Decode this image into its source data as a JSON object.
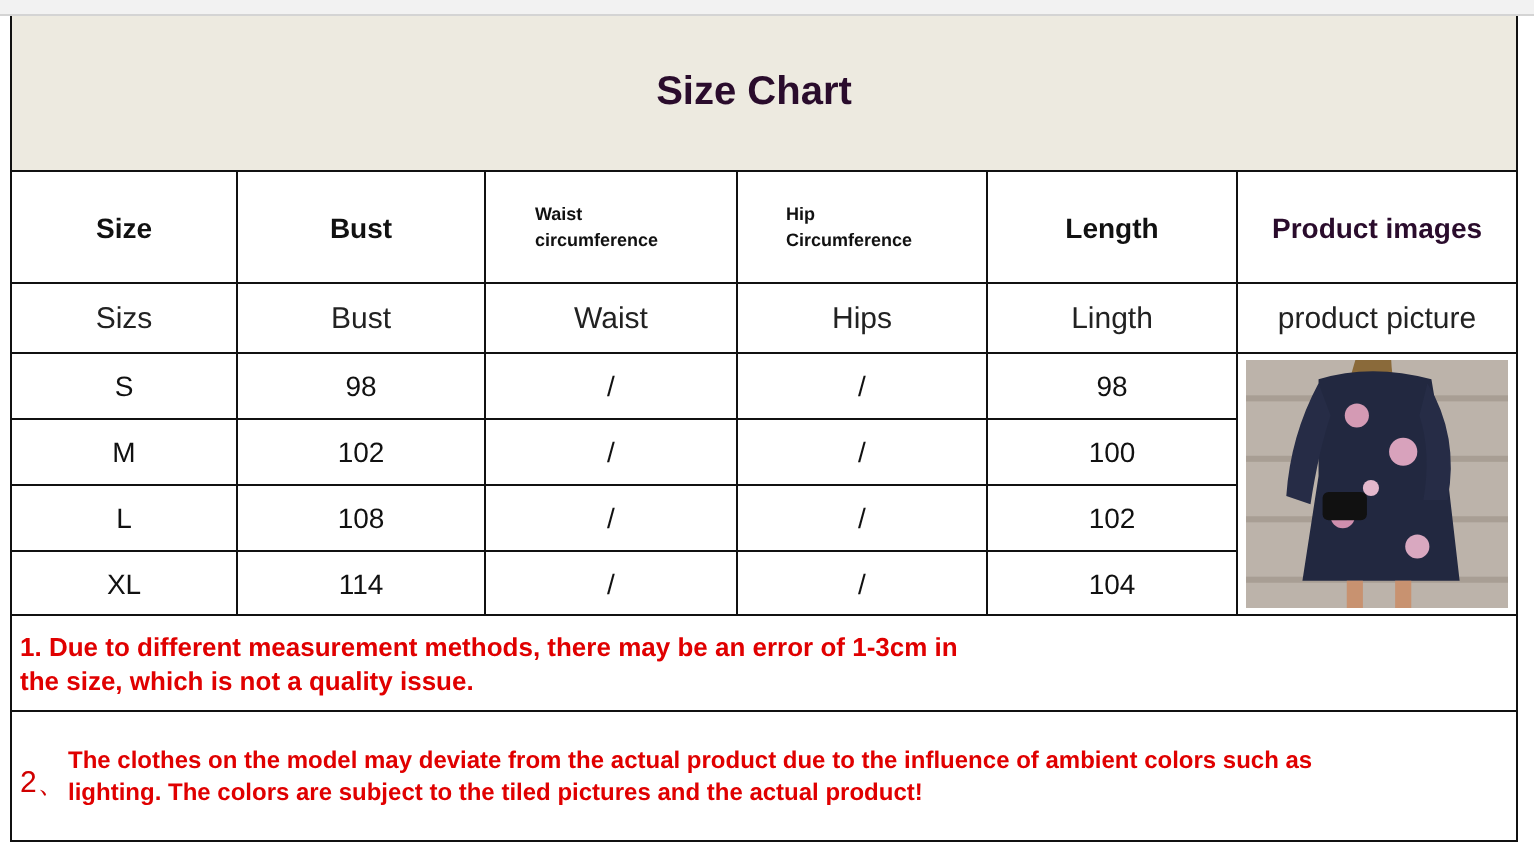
{
  "title": "Size Chart",
  "columns": [
    {
      "header": "Size",
      "kind": "large",
      "label": "Sizs"
    },
    {
      "header": "Bust",
      "kind": "large",
      "label": "Bust"
    },
    {
      "header": "Waist circumference",
      "kind": "small",
      "label": "Waist"
    },
    {
      "header": "Hip Circumference",
      "kind": "small",
      "label": "Hips"
    },
    {
      "header": "Length",
      "kind": "large",
      "label": "Lingth"
    },
    {
      "header": "Product images",
      "kind": "large",
      "label": "product picture"
    }
  ],
  "rows": [
    [
      "S",
      "98",
      "/",
      "/",
      "98"
    ],
    [
      "M",
      "102",
      "/",
      "/",
      "100"
    ],
    [
      "L",
      "108",
      "/",
      "/",
      "102"
    ],
    [
      "XL",
      "114",
      "/",
      "/",
      "104"
    ]
  ],
  "notes": [
    {
      "text": "1. Due to different measurement methods, there may be an error of 1-3cm in the size, which is not a quality issue."
    },
    {
      "number": "2、",
      "text": "The clothes on the model may deviate from the actual product due to the influence of ambient colors such as lighting. The colors are subject to the tiled pictures and the actual product!"
    }
  ]
}
